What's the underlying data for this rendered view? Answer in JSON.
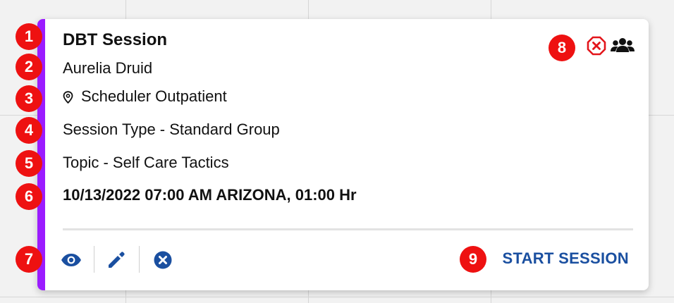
{
  "colors": {
    "accent": "#9b1bff",
    "primary": "#1a4fa0",
    "danger": "#e3151b",
    "badge": "#ee1111",
    "text": "#111111"
  },
  "session": {
    "title": "DBT Session",
    "client_name": "Aurelia Druid",
    "location": "Scheduler Outpatient",
    "session_type": "Session Type - Standard Group",
    "topic": "Topic - Self Care Tactics",
    "datetime": "10/13/2022 07:00 AM ARIZONA, 01:00 Hr"
  },
  "header_icons": [
    {
      "name": "cancel-session-icon",
      "icon": "x-octagon"
    },
    {
      "name": "group-icon",
      "icon": "users"
    }
  ],
  "actions": [
    {
      "name": "view-icon",
      "icon": "eye"
    },
    {
      "name": "edit-icon",
      "icon": "pencil"
    },
    {
      "name": "cancel-icon",
      "icon": "x-circle"
    }
  ],
  "start_session_label": "START SESSION",
  "badges": [
    "1",
    "2",
    "3",
    "4",
    "5",
    "6",
    "7",
    "8",
    "9"
  ]
}
